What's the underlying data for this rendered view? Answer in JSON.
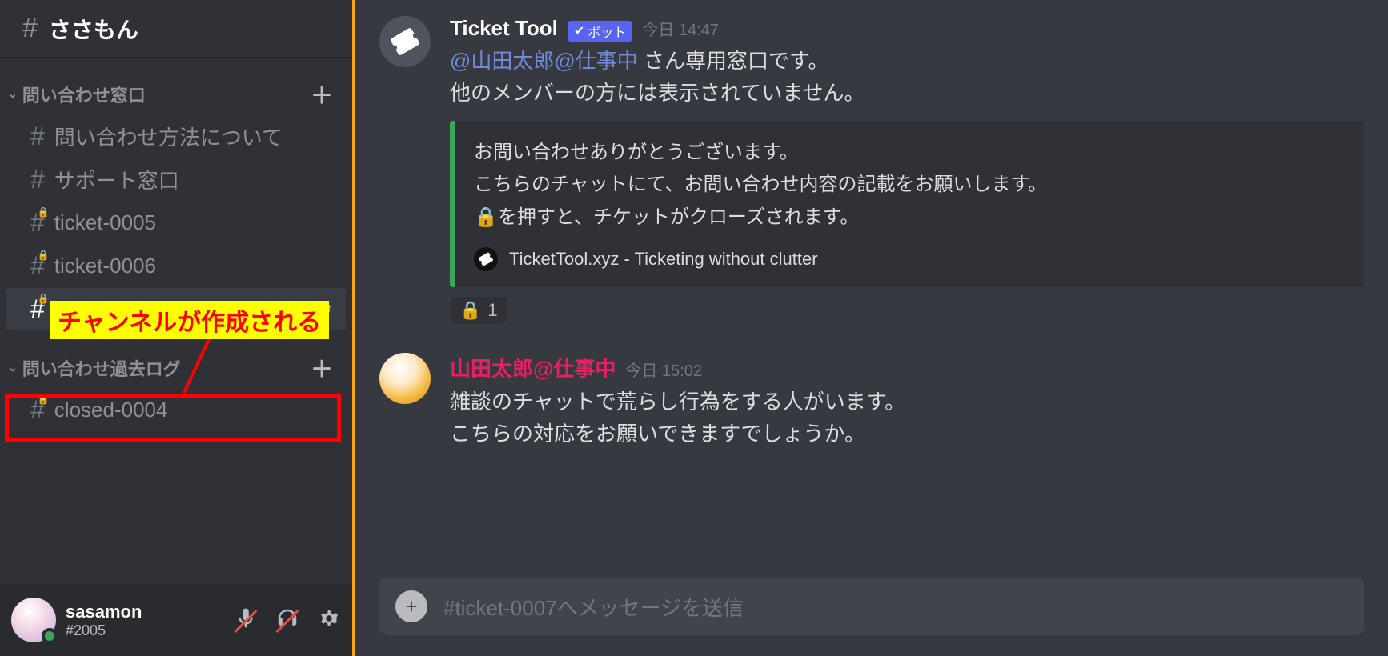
{
  "channel_header": {
    "hash": "#",
    "name": "ささもん"
  },
  "categories": [
    {
      "name": "問い合わせ窓口",
      "channels": [
        {
          "name": "問い合わせ方法について",
          "locked": false,
          "active": false
        },
        {
          "name": "サポート窓口",
          "locked": false,
          "active": false
        },
        {
          "name": "ticket-0005",
          "locked": true,
          "active": false
        },
        {
          "name": "ticket-0006",
          "locked": true,
          "active": false
        },
        {
          "name": "ticket-0007",
          "locked": true,
          "active": true
        }
      ]
    },
    {
      "name": "問い合わせ過去ログ",
      "channels": [
        {
          "name": "closed-0004",
          "locked": true,
          "active": false
        }
      ]
    }
  ],
  "annotation": {
    "callout": "チャンネルが作成される"
  },
  "user_panel": {
    "name": "sasamon",
    "tag": "#2005"
  },
  "messages": [
    {
      "author": "Ticket Tool",
      "is_bot": true,
      "bot_label": "ボット",
      "timestamp": "今日 14:47",
      "mention": "@山田太郎@仕事中",
      "line1_tail": " さん専用窓口です。",
      "line2": "他のメンバーの方には表示されていません。",
      "embed": {
        "line1": "お問い合わせありがとうございます。",
        "line2": "こちらのチャットにて、お問い合わせ内容の記載をお願いします。",
        "line3_prefix": "🔒",
        "line3_tail": "を押すと、チケットがクローズされます。",
        "footer": "TicketTool.xyz - Ticketing without clutter"
      },
      "reaction": {
        "emoji": "🔒",
        "count": "1"
      }
    },
    {
      "author": "山田太郎@仕事中",
      "is_bot": false,
      "timestamp": "今日 15:02",
      "line1": "雑談のチャットで荒らし行為をする人がいます。",
      "line2": "こちらの対応をお願いできますでしょうか。"
    }
  ],
  "composer": {
    "placeholder": "#ticket-0007へメッセージを送信"
  }
}
